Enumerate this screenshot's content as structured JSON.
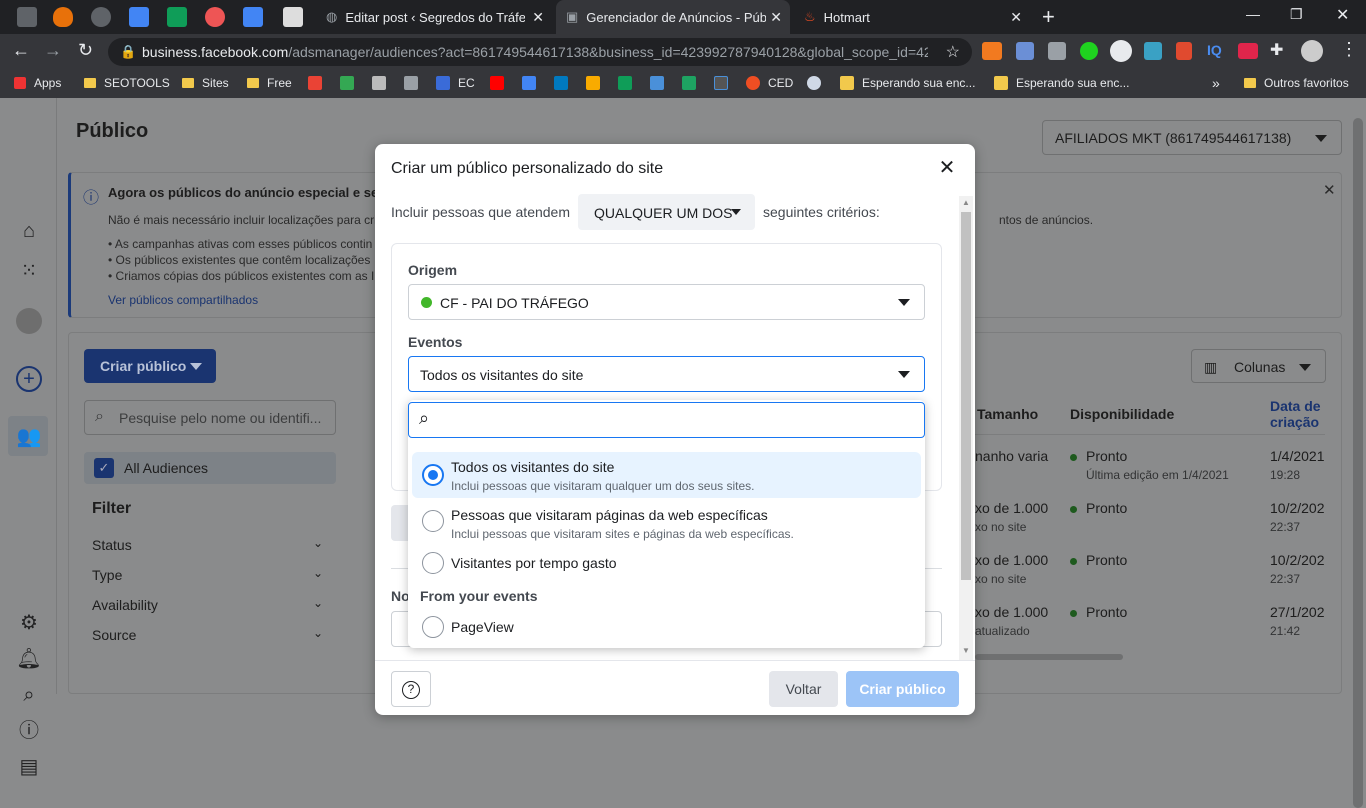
{
  "browser": {
    "tabs": [
      {
        "title": "Editar post ‹ Segredos do Tráfego",
        "close": "✕"
      },
      {
        "title": "Gerenciador de Anúncios - Públic",
        "close": "✕"
      },
      {
        "title": "Hotmart",
        "close": "✕"
      }
    ],
    "new_tab": "+",
    "url_host": "business.facebook.com",
    "url_rest": "/adsmanager/audiences?act=861749544617138&business_id=423992787940128&global_scope_id=42...",
    "bookmarks": [
      "Apps",
      "SEOTOOLS",
      "Sites",
      "Free",
      "EC",
      "CED",
      "Esperando sua enc...",
      "Esperando sua enc...",
      "»",
      "Outros favoritos"
    ]
  },
  "page": {
    "title": "Público",
    "account": "AFILIADOS MKT (861749544617138)",
    "notice": {
      "heading": "Agora os públicos do anúncio especial e seme",
      "line1": "Não é mais necessário incluir localizações para cri",
      "line1_end": "ntos de anúncios.",
      "bullets": [
        "• As campanhas ativas com esses públicos contin",
        "• Os públicos existentes que contêm localizações",
        "• Criamos cópias dos públicos existentes com as I"
      ],
      "link": "Ver públicos compartilhados",
      "close": "✕"
    },
    "create_button": "Criar público",
    "search_placeholder": "Pesquise pelo nome ou identifi...",
    "all_audiences": "All Audiences",
    "filter": {
      "title": "Filter",
      "items": [
        "Status",
        "Type",
        "Availability",
        "Source"
      ]
    },
    "columns_button": "Colunas",
    "table": {
      "headers": {
        "size": "Tamanho",
        "availability": "Disponibilidade",
        "created1": "Data de",
        "created2": "criação"
      },
      "rows": [
        {
          "size": "nanho varia",
          "size2": "",
          "status": "Pronto",
          "status2": "Última edição em 1/4/2021",
          "date": "1/4/2021",
          "time": "19:28"
        },
        {
          "size": "xo de 1.000",
          "size2": "xo no site",
          "status": "Pronto",
          "status2": "",
          "date": "10/2/202",
          "time": "22:37"
        },
        {
          "size": "xo de 1.000",
          "size2": "xo no site",
          "status": "Pronto",
          "status2": "",
          "date": "10/2/202",
          "time": "22:37"
        },
        {
          "size": "xo de 1.000",
          "size2": "atualizado",
          "status": "Pronto",
          "status2": "",
          "date": "27/1/202",
          "time": "21:42"
        }
      ]
    }
  },
  "modal": {
    "title": "Criar um público personalizado do site",
    "include_prefix": "Incluir pessoas que atendem",
    "match_select": "QUALQUER UM DOS",
    "include_suffix": "seguintes critérios:",
    "origem_label": "Origem",
    "origem_value": "CF - PAI DO TRÁFEGO",
    "eventos_label": "Eventos",
    "eventos_value": "Todos os visitantes do site",
    "search_value": "",
    "options": [
      {
        "title": "Todos os visitantes do site",
        "sub": "Inclui pessoas que visitaram qualquer um dos seus sites."
      },
      {
        "title": "Pessoas que visitaram páginas da web específicas",
        "sub": "Inclui pessoas que visitaram sites e páginas da web específicas."
      },
      {
        "title": "Visitantes por tempo gasto",
        "sub": ""
      }
    ],
    "events_section": "From your events",
    "event_options": [
      {
        "title": "PageView"
      }
    ],
    "name_label_partial": "No",
    "help": "?",
    "back_button": "Voltar",
    "create_button": "Criar público",
    "colors": {
      "primary": "#1877f2",
      "origem_dot": "#42b72a",
      "disabled": "#9cc4f7"
    }
  }
}
